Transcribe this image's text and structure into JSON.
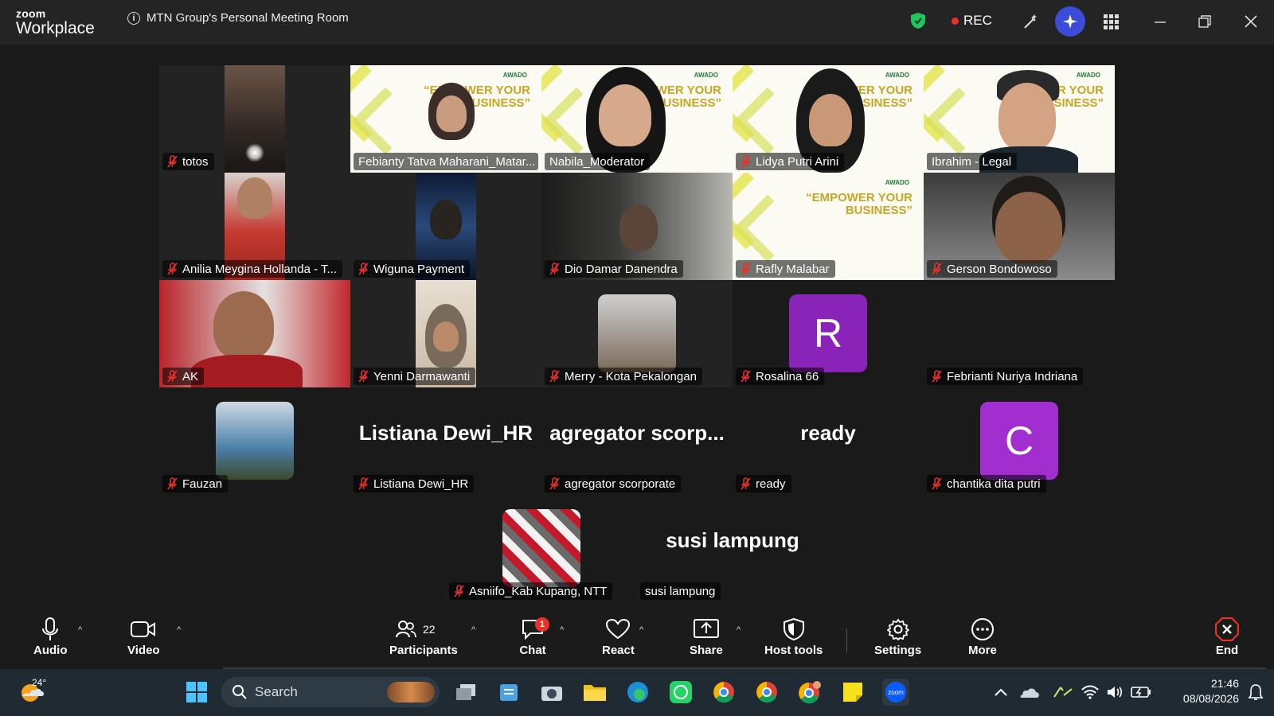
{
  "window": {
    "logo_line1": "zoom",
    "logo_line2": "Workplace",
    "meeting_title": "MTN Group's Personal Meeting Room",
    "rec_label": "REC",
    "icons": [
      "info-icon",
      "security-shield-icon",
      "record-dot-icon",
      "annotate-icon",
      "ai-companion-icon",
      "apps-grid-icon",
      "minimize-icon",
      "restore-icon",
      "close-icon"
    ]
  },
  "banner": {
    "line1": "“EMPOWER YOUR",
    "line2": "BUSINESS”",
    "brand": "AWADO"
  },
  "participants": [
    {
      "name": "totos"
    },
    {
      "name": "Febianty Tatva Maharani_Matar..."
    },
    {
      "name": "Nabila_Moderator"
    },
    {
      "name": "Lidya Putri Arini"
    },
    {
      "name": "Ibrahim - Legal"
    },
    {
      "name": "Anilia Meygina Hollanda - T..."
    },
    {
      "name": "Wiguna Payment"
    },
    {
      "name": "Dio Damar Danendra"
    },
    {
      "name": "Rafly Malabar"
    },
    {
      "name": "Gerson Bondowoso"
    },
    {
      "name": "AK"
    },
    {
      "name": "Yenni Darmawanti"
    },
    {
      "name": "Merry - Kota Pekalongan"
    },
    {
      "name": "Rosalina 66",
      "initial": "R"
    },
    {
      "name": "Febrianti Nuriya Indriana"
    },
    {
      "name": "Fauzan"
    },
    {
      "name": "Listiana Dewi_HR",
      "big": "Listiana Dewi_HR"
    },
    {
      "name": "agregator scorporate",
      "big": "agregator  scorp..."
    },
    {
      "name": "ready",
      "big": "ready"
    },
    {
      "name": "chantika dita putri",
      "initial": "C"
    },
    {
      "name": "Asniifo_Kab Kupang, NTT"
    },
    {
      "name": "susi lampung",
      "big": "susi lampung"
    }
  ],
  "toolbar": {
    "audio": "Audio",
    "video": "Video",
    "participants": "Participants",
    "participants_count": "22",
    "chat": "Chat",
    "chat_badge": "1",
    "react": "React",
    "share": "Share",
    "host_tools": "Host tools",
    "settings": "Settings",
    "more": "More",
    "end": "End"
  },
  "taskbar": {
    "weather_temp": "24°",
    "search_placeholder": "Search",
    "time": "21:46",
    "date": "08/08/2026"
  },
  "colors": {
    "active_speaker": "#23d160",
    "rec_dot": "#e5332a",
    "rosalina_avatar": "#8a24b8",
    "chantika_avatar": "#a22ed0"
  }
}
